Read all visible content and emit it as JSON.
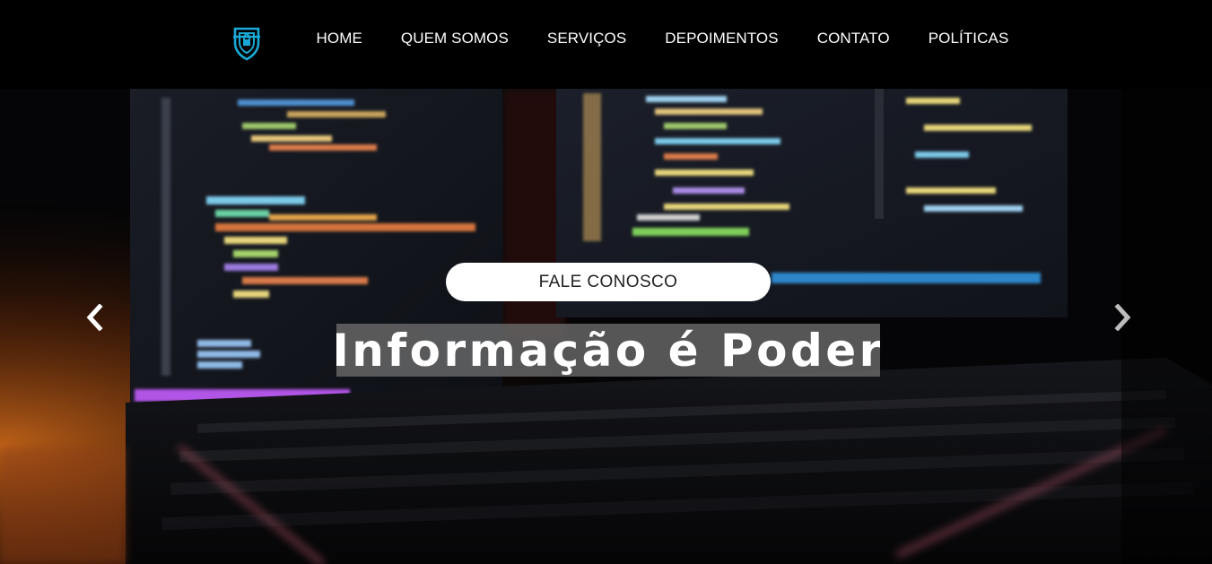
{
  "nav": {
    "logo_icon": "shield-lock-icon",
    "links": [
      {
        "label": "HOME"
      },
      {
        "label": "QUEM SOMOS"
      },
      {
        "label": "SERVIÇOS"
      },
      {
        "label": "DEPOIMENTOS"
      },
      {
        "label": "CONTATO"
      },
      {
        "label": "POLÍTICAS"
      }
    ]
  },
  "hero": {
    "cta_label": "FALE CONOSCO",
    "headline": "Informação é Poder",
    "prev_icon": "chevron-left-icon",
    "next_icon": "chevron-right-icon"
  },
  "colors": {
    "nav_background": "#000000",
    "logo_accent": "#19a9d6",
    "headline_background": "#696969",
    "cta_background": "#ffffff"
  }
}
